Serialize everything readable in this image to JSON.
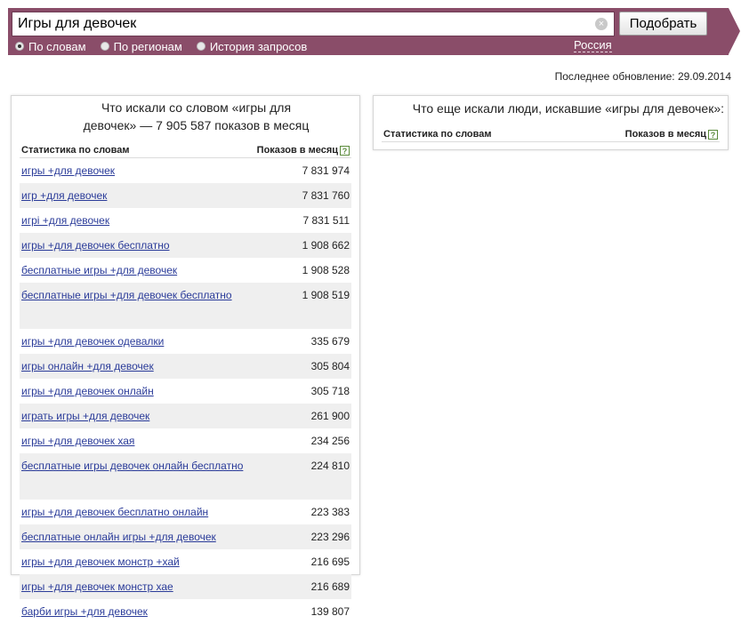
{
  "search": {
    "query": "Игры для девочек",
    "button_label": "Подобрать",
    "clear_glyph": "×",
    "radios": [
      {
        "label": "По словам",
        "checked": true
      },
      {
        "label": "По регионам",
        "checked": false
      },
      {
        "label": "История запросов",
        "checked": false
      }
    ],
    "region": "Россия"
  },
  "last_update": "Последнее обновление: 29.09.2014",
  "left_panel": {
    "title_line1": "Что искали со словом «игры для",
    "title_line2": "девочек» — 7 905 587 показов в месяц",
    "col_words": "Статистика по словам",
    "col_count": "Показов в месяц",
    "help_glyph": "?",
    "rows": [
      {
        "phrase": "игры +для девочек",
        "count": "7 831 974"
      },
      {
        "phrase": "игр +для девочек",
        "count": "7 831 760"
      },
      {
        "phrase": "игрi +для девочек",
        "count": "7 831 511"
      },
      {
        "phrase": "игры +для девочек бесплатно",
        "count": "1 908 662"
      },
      {
        "phrase": "бесплатные игры +для девочек",
        "count": "1 908 528"
      },
      {
        "phrase": "бесплатные игры +для девочек бесплатно",
        "count": "1 908 519"
      },
      {
        "phrase": "игры +для девочек одевалки",
        "count": "335 679"
      },
      {
        "phrase": "игры онлайн +для девочек",
        "count": "305 804"
      },
      {
        "phrase": "игры +для девочек онлайн",
        "count": "305 718"
      },
      {
        "phrase": "играть игры +для девочек",
        "count": "261 900"
      },
      {
        "phrase": "игры +для девочек хая",
        "count": "234 256"
      },
      {
        "phrase": "бесплатные игры девочек онлайн бесплатно",
        "count": "224 810"
      },
      {
        "phrase": "игры +для девочек бесплатно онлайн",
        "count": "223 383"
      },
      {
        "phrase": "бесплатные онлайн игры +для девочек",
        "count": "223 296"
      },
      {
        "phrase": "игры +для девочек монстр +хай",
        "count": "216 695"
      },
      {
        "phrase": "игры +для девочек монстр хае",
        "count": "216 689"
      },
      {
        "phrase": "барби игры +для девочек",
        "count": "139 807"
      }
    ]
  },
  "right_panel": {
    "title": "Что еще искали люди, искавшие «игры для девочек»:",
    "col_words": "Статистика по словам",
    "col_count": "Показов в месяц",
    "help_glyph": "?"
  }
}
